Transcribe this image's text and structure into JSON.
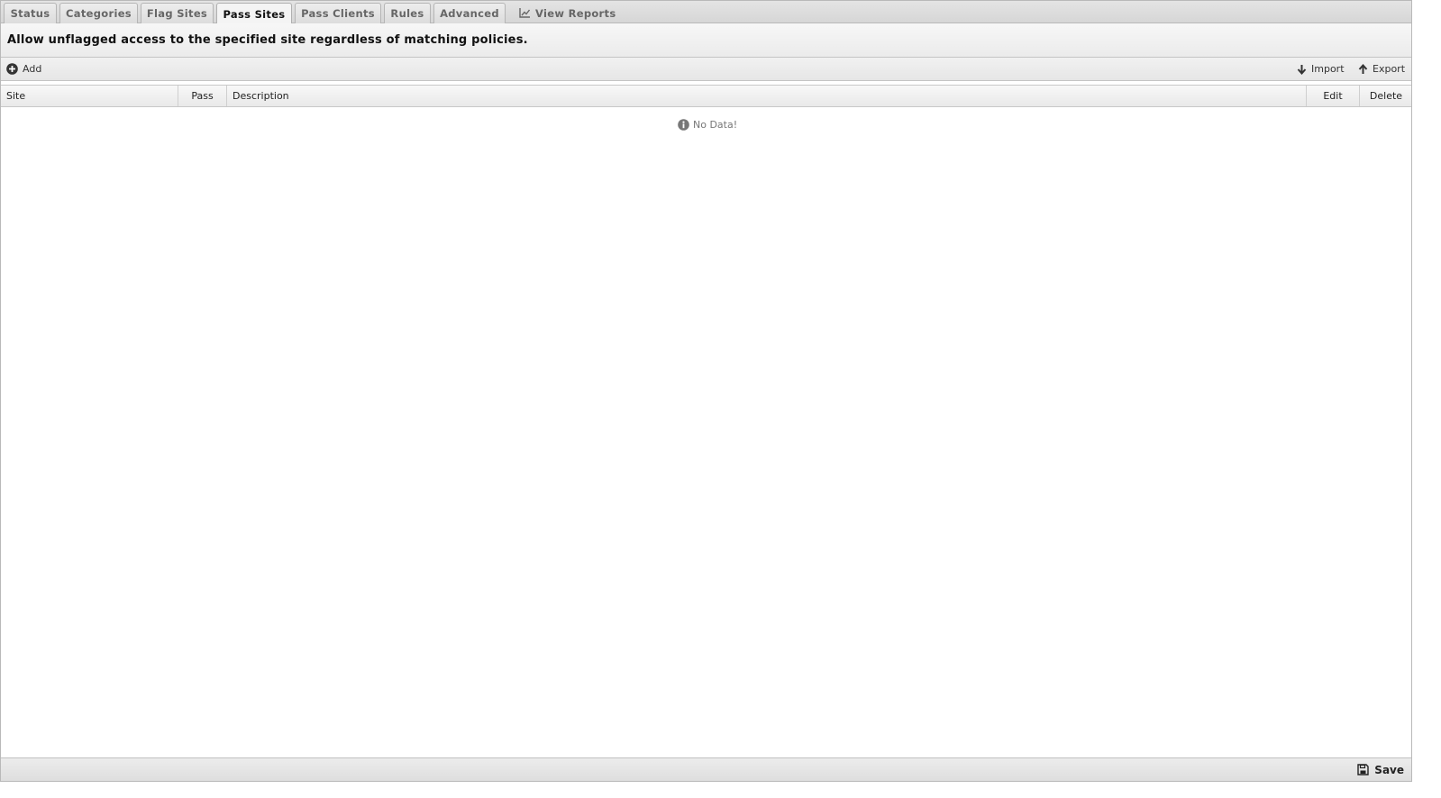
{
  "tabs": [
    {
      "label": "Status"
    },
    {
      "label": "Categories"
    },
    {
      "label": "Flag Sites"
    },
    {
      "label": "Pass Sites",
      "active": true
    },
    {
      "label": "Pass Clients"
    },
    {
      "label": "Rules"
    },
    {
      "label": "Advanced"
    }
  ],
  "view_reports": {
    "label": "View Reports",
    "icon": "line-chart-icon"
  },
  "description": "Allow unflagged access to the specified site regardless of matching policies.",
  "toolbar": {
    "add_label": "Add",
    "import_label": "Import",
    "export_label": "Export"
  },
  "grid": {
    "columns": [
      "Site",
      "Pass",
      "Description",
      "Edit",
      "Delete"
    ],
    "rows": [],
    "empty_text": "No Data!"
  },
  "footer": {
    "save_label": "Save"
  },
  "colors": {
    "tab_bg": "#dcdcdc",
    "active_tab_bg": "#f4f4f4",
    "border": "#b9b9b9",
    "muted_text": "#777777"
  }
}
